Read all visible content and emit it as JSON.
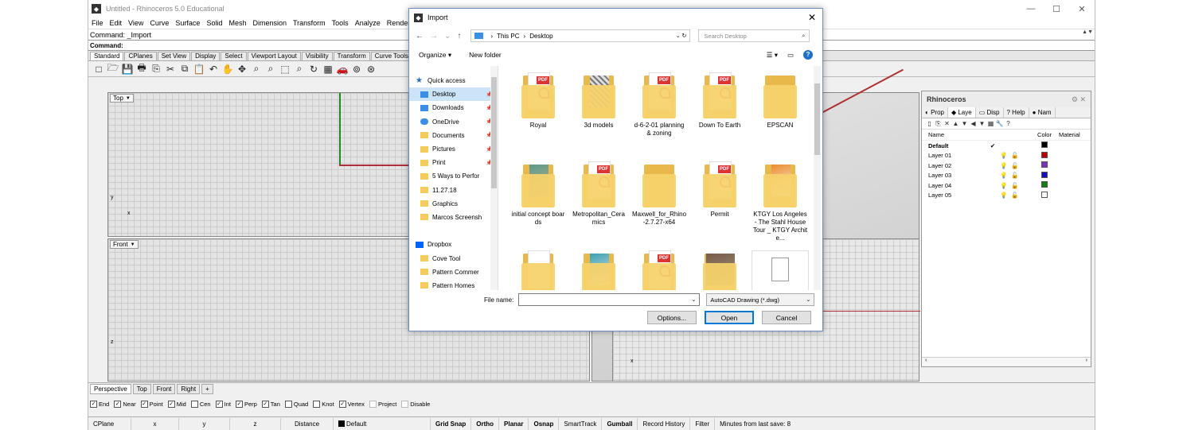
{
  "app": {
    "title": "Untitled - Rhinoceros 5.0 Educational",
    "window_controls": [
      "—",
      "☐",
      "✕"
    ]
  },
  "menu": [
    "File",
    "Edit",
    "View",
    "Curve",
    "Surface",
    "Solid",
    "Mesh",
    "Dimension",
    "Transform",
    "Tools",
    "Analyze",
    "Render"
  ],
  "command": {
    "history": "Command: _Import",
    "prompt": "Command:"
  },
  "toolbar_tabs": [
    "Standard",
    "CPlanes",
    "Set View",
    "Display",
    "Select",
    "Viewport Layout",
    "Visibility",
    "Transform",
    "Curve Tools"
  ],
  "toolbar_tab_right": "ession",
  "toolbar_icons": [
    "□",
    "🗁",
    "💾",
    "🖶",
    "⎘",
    "✂",
    "⧉",
    "📋",
    "↶",
    "✋",
    "✥",
    "⌕",
    "⌕",
    "⬚",
    "⌕",
    "↻",
    "▦",
    "🚗",
    "⊚",
    "⊛"
  ],
  "viewports": {
    "top": "Top",
    "front": "Front",
    "axis_y": "y",
    "axis_x": "x",
    "axis_z": "z",
    "axis_x2": "x"
  },
  "view_tabs": [
    "Perspective",
    "Top",
    "Front",
    "Right",
    "+"
  ],
  "osnaps": [
    {
      "label": "End",
      "checked": true
    },
    {
      "label": "Near",
      "checked": true
    },
    {
      "label": "Point",
      "checked": true
    },
    {
      "label": "Mid",
      "checked": true
    },
    {
      "label": "Cen",
      "checked": false
    },
    {
      "label": "Int",
      "checked": true
    },
    {
      "label": "Perp",
      "checked": true
    },
    {
      "label": "Tan",
      "checked": true
    },
    {
      "label": "Quad",
      "checked": false
    },
    {
      "label": "Knot",
      "checked": false
    },
    {
      "label": "Vertex",
      "checked": true
    },
    {
      "label": "Project",
      "checked": false
    },
    {
      "label": "Disable",
      "checked": false
    }
  ],
  "status": {
    "cplane": "CPlane",
    "x": "x",
    "y": "y",
    "z": "z",
    "distance": "Distance",
    "layer": "Default",
    "grid_snap": "Grid Snap",
    "ortho": "Ortho",
    "planar": "Planar",
    "osnap": "Osnap",
    "smarttrack": "SmartTrack",
    "gumball": "Gumball",
    "record_history": "Record History",
    "filter": "Filter",
    "minutes": "Minutes from last save: 8"
  },
  "panel": {
    "title": "Rhinoceros",
    "tabs": [
      "Prop",
      "Laye",
      "Disp",
      "Help",
      "Nam"
    ],
    "tool_icons": [
      "▯",
      "⎘",
      "✕",
      "▲",
      "▼",
      "◀",
      "▼",
      "▦",
      "🔧",
      "?"
    ],
    "columns": {
      "name": "Name",
      "color": "Color",
      "material": "Material"
    },
    "layers": [
      {
        "name": "Default",
        "current": "✔",
        "color": "#000000"
      },
      {
        "name": "Layer 01",
        "color": "#c00000"
      },
      {
        "name": "Layer 02",
        "color": "#8030c0"
      },
      {
        "name": "Layer 03",
        "color": "#1010c0"
      },
      {
        "name": "Layer 04",
        "color": "#108010"
      },
      {
        "name": "Layer 05",
        "color": "#ffffff"
      }
    ],
    "on_icon": "💡",
    "lock_icon": "🔓"
  },
  "dialog": {
    "title": "Import",
    "path": [
      "This PC",
      "Desktop"
    ],
    "search_placeholder": "Search Desktop",
    "organize": "Organize ▾",
    "new_folder": "New folder",
    "nav": [
      {
        "label": "Quick access",
        "icon": "star",
        "indent": 8
      },
      {
        "label": "Desktop",
        "icon": "blue",
        "indent": 14,
        "pin": "📌",
        "selected": true
      },
      {
        "label": "Downloads",
        "icon": "dl",
        "indent": 14,
        "pin": "📌"
      },
      {
        "label": "OneDrive",
        "icon": "cloud",
        "indent": 14,
        "pin": "📌"
      },
      {
        "label": "Documents",
        "icon": "fold",
        "indent": 14,
        "pin": "📌"
      },
      {
        "label": "Pictures",
        "icon": "fold",
        "indent": 14,
        "pin": "📌"
      },
      {
        "label": "Print",
        "icon": "fold",
        "indent": 14,
        "pin": "📌"
      },
      {
        "label": "5 Ways to Perfor",
        "icon": "fold",
        "indent": 14
      },
      {
        "label": "11.27.18",
        "icon": "fold",
        "indent": 14
      },
      {
        "label": "Graphics",
        "icon": "fold",
        "indent": 14
      },
      {
        "label": "Marcos Screensh",
        "icon": "fold",
        "indent": 14
      },
      {
        "label": "",
        "icon": "",
        "indent": 14
      },
      {
        "label": "Dropbox",
        "icon": "box",
        "indent": 8
      },
      {
        "label": "Cove Tool",
        "icon": "fold",
        "indent": 14
      },
      {
        "label": "Pattern Commer",
        "icon": "fold",
        "indent": 14
      },
      {
        "label": "Pattern Homes",
        "icon": "fold",
        "indent": 14
      }
    ],
    "files": [
      {
        "label": "Royal",
        "kind": "pdf"
      },
      {
        "label": "3d models",
        "kind": "img1"
      },
      {
        "label": "d-6-2-01 planning & zoning",
        "kind": "pdf"
      },
      {
        "label": "Down To Earth",
        "kind": "pdf"
      },
      {
        "label": "EPSCAN",
        "kind": "plain"
      },
      {
        "label": "initial concept boards",
        "kind": "img2"
      },
      {
        "label": "Metropolitan_Ceramics",
        "kind": "pdf"
      },
      {
        "label": "Maxwell_for_Rhino-2.7.27-x64",
        "kind": "plain"
      },
      {
        "label": "Permit",
        "kind": "pdf"
      },
      {
        "label": "KTGY Los Angeles - The Stahl House Tour _ KTGY Archite...",
        "kind": "img3"
      },
      {
        "label": "",
        "kind": "paper"
      },
      {
        "label": "",
        "kind": "img4"
      },
      {
        "label": "",
        "kind": "pdf"
      },
      {
        "label": "",
        "kind": "img5"
      },
      {
        "label": "",
        "kind": "dwg"
      }
    ],
    "filename_label": "File name:",
    "filename_value": "",
    "filetype": "AutoCAD Drawing (*.dwg)",
    "buttons": {
      "options": "Options...",
      "open": "Open",
      "cancel": "Cancel"
    }
  }
}
